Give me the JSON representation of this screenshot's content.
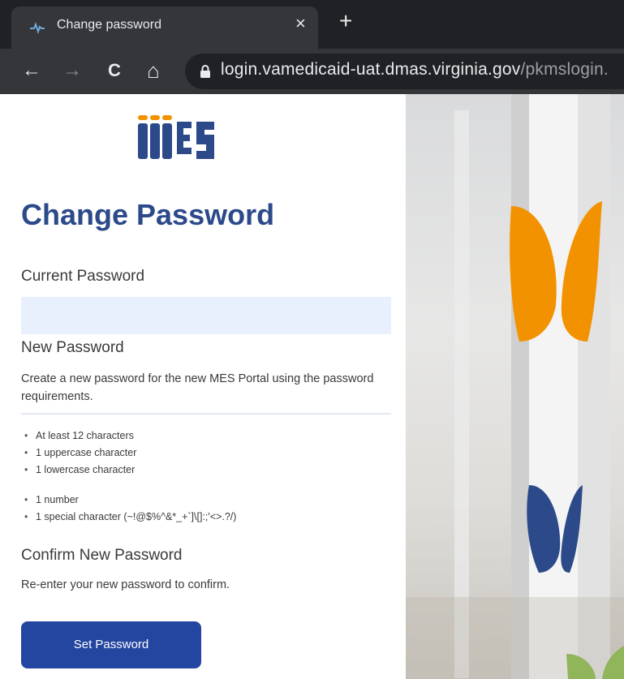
{
  "browser": {
    "tab_title": "Change password",
    "close_glyph": "×",
    "new_tab_glyph": "+",
    "back_glyph": "←",
    "forward_glyph": "→",
    "reload_glyph": "C",
    "home_glyph": "⌂",
    "url_host": "login.vamedicaid-uat.dmas.virginia.gov",
    "url_path": "/pkmslogin."
  },
  "icons": {
    "favicon": "pulse-icon",
    "lock": "lock-icon",
    "logo": "mes-logo"
  },
  "form": {
    "title": "Change Password",
    "current_password_label": "Current Password",
    "current_password_value": "",
    "new_password_label": "New Password",
    "new_password_help": "Create a new password for the new MES Portal using the password requirements.",
    "requirements_group_1": [
      "At least 12 characters",
      "1 uppercase character",
      "1 lowercase character"
    ],
    "requirements_group_2": [
      "1 number",
      "1 special character (~!@$%^&*_+`]\\[]:;'<>.?/)"
    ],
    "confirm_password_label": "Confirm New Password",
    "confirm_password_help": "Re-enter your new password to confirm.",
    "submit_label": "Set Password"
  },
  "colors": {
    "brand_blue": "#2c4a8a",
    "button_blue": "#2446a0",
    "input_fill": "#e8f0fe",
    "accent_orange": "#f39200",
    "accent_green": "#7ab530"
  }
}
